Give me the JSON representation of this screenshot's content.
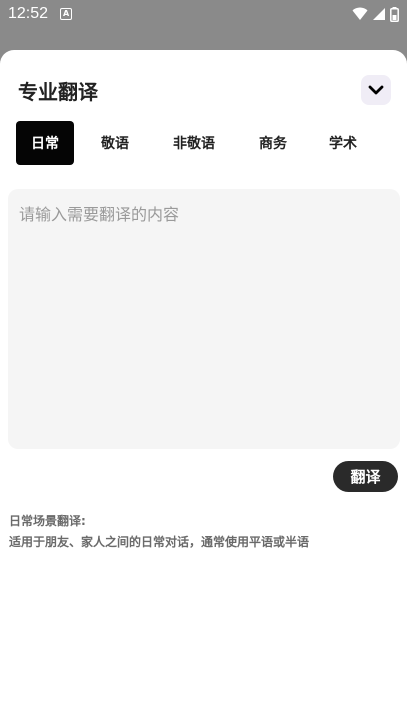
{
  "status_bar": {
    "time": "12:52",
    "notification_icon": "a-letter-icon",
    "icons": [
      "wifi-icon",
      "signal-icon",
      "battery-icon"
    ]
  },
  "sheet": {
    "title": "专业翻译",
    "collapse_icon": "chevron-down-icon"
  },
  "tabs": [
    {
      "label": "日常",
      "active": true
    },
    {
      "label": "敬语",
      "active": false
    },
    {
      "label": "非敬语",
      "active": false
    },
    {
      "label": "商务",
      "active": false
    },
    {
      "label": "学术",
      "active": false
    }
  ],
  "input": {
    "placeholder": "请输入需要翻译的内容",
    "value": ""
  },
  "translate_button": {
    "label": "翻译"
  },
  "description": {
    "heading": "日常场景翻译:",
    "body": "适用于朋友、家人之间的日常对话，通常使用平语或半语"
  },
  "colors": {
    "active_tab_bg": "#050505",
    "button_bg": "#2a2a2a",
    "input_bg": "#f5f5f5",
    "collapse_bg": "#f0edf6"
  }
}
